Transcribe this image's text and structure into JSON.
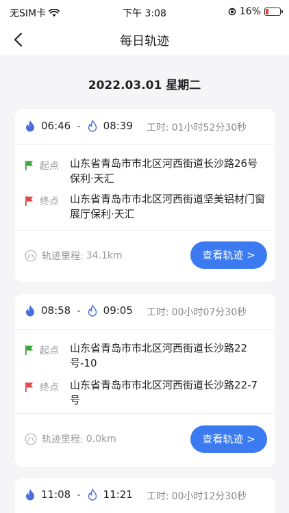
{
  "status_bar": {
    "carrier": "无SIM卡",
    "time": "下午 3:08",
    "battery_percent": "16%"
  },
  "nav": {
    "title": "每日轨迹",
    "back_icon": "chevron-left-icon"
  },
  "date_header": "2022.03.01 星期二",
  "labels": {
    "worktime_prefix": "工时:",
    "start": "起点",
    "end": "终点",
    "mileage_prefix": "轨迹里程:",
    "view_button": "查看轨迹 >"
  },
  "colors": {
    "accent": "#3b7af0",
    "start_flag": "#3aa53a",
    "end_flag": "#e04848",
    "fire": "#4a6ee0"
  },
  "tracks": [
    {
      "start_time": "06:46",
      "end_time": "08:39",
      "worktime": "01小时52分30秒",
      "start_address": "山东省青岛市市北区河西街道长沙路26号保利·天汇",
      "end_address": "山东省青岛市市北区河西街道坚美铝材门窗展厅保利·天汇",
      "mileage": "34.1km"
    },
    {
      "start_time": "08:58",
      "end_time": "09:05",
      "worktime": "00小时07分30秒",
      "start_address": "山东省青岛市市北区河西街道长沙路22号-10",
      "end_address": "山东省青岛市市北区河西街道长沙路22-7号",
      "mileage": "0.0km"
    },
    {
      "start_time": "11:08",
      "end_time": "11:21",
      "worktime": "00小时12分30秒"
    }
  ]
}
